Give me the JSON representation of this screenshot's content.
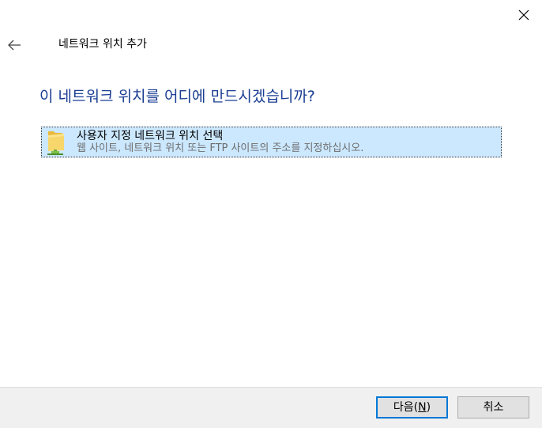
{
  "window": {
    "title": "네트워크 위치 추가"
  },
  "main": {
    "heading": "이 네트워크 위치를 어디에 만드시겠습니까?",
    "options": [
      {
        "title": "사용자 지정 네트워크 위치 선택",
        "description": "웹 사이트, 네트워크 위치 또는 FTP 사이트의 주소를 지정하십시오.",
        "icon": "folder-network-icon",
        "selected": true
      }
    ]
  },
  "footer": {
    "next_label_prefix": "다음(",
    "next_label_accel": "N",
    "next_label_suffix": ")",
    "cancel_label": "취소"
  },
  "colors": {
    "heading": "#1a3d93",
    "selection_bg": "#cce8ff",
    "primary_border": "#0078d7"
  }
}
